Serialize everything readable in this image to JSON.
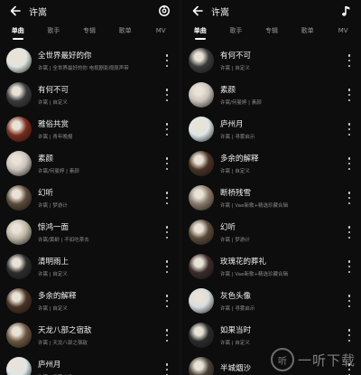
{
  "left": {
    "title": "许嵩",
    "tabs": [
      "单曲",
      "歌手",
      "专辑",
      "歌单",
      "MV"
    ],
    "active_tab": "单曲",
    "top_icon": "shazam-recognize-icon",
    "songs": [
      {
        "name": "全世界最好的你",
        "meta": "许嵩 | 全世界最好的你 电视剧影视原声带",
        "cover": "#dfe6df"
      },
      {
        "name": "有何不可",
        "meta": "许嵩 | 自定义",
        "cover": "#3a3a3a"
      },
      {
        "name": "雅俗共赏",
        "meta": "许嵩 | 青年晚报",
        "cover": "#7a2c1c"
      },
      {
        "name": "素颜",
        "meta": "许嵩/何曼婷 | 素颜",
        "cover": "#c9c3ba"
      },
      {
        "name": "幻听",
        "meta": "许嵩 | 梦游计",
        "cover": "#5a4a3a"
      },
      {
        "name": "惊鸿一面",
        "meta": "许嵩/黄龄 | 不如吃茶去",
        "cover": "#bdb6a6"
      },
      {
        "name": "清明雨上",
        "meta": "许嵩 | 自定义",
        "cover": "#2c2c2c"
      },
      {
        "name": "多余的解释",
        "meta": "许嵩 | 自定义",
        "cover": "#4a3324"
      },
      {
        "name": "天龙八部之宿敌",
        "meta": "许嵩 | 天龙八部之宿敌",
        "cover": "#6b5540"
      },
      {
        "name": "庐州月",
        "meta": "许嵩 | 寻雾启示",
        "cover": "#dde6e8"
      }
    ]
  },
  "right": {
    "title": "许嵩",
    "tabs": [
      "单曲",
      "歌手",
      "专辑",
      "歌单",
      "MV"
    ],
    "active_tab": "单曲",
    "top_icon": "music-note-icon",
    "songs": [
      {
        "name": "有何不可",
        "meta": "许嵩 | 自定义",
        "cover": "#3a3a3a"
      },
      {
        "name": "素颜",
        "meta": "许嵩/何曼婷 | 素颜",
        "cover": "#c9c3ba"
      },
      {
        "name": "庐州月",
        "meta": "许嵩 | 寻雾启示",
        "cover": "#dde6e8"
      },
      {
        "name": "多余的解释",
        "meta": "许嵩 | 自定义",
        "cover": "#4a3324"
      },
      {
        "name": "断桥残雪",
        "meta": "许嵩 | Vae新歌+精选珍藏合辑",
        "cover": "#8a7a6a"
      },
      {
        "name": "幻听",
        "meta": "许嵩 | 梦游计",
        "cover": "#5a4a3a"
      },
      {
        "name": "玫瑰花的葬礼",
        "meta": "许嵩 | Vae新歌+精选珍藏合辑",
        "cover": "#3b2a2a"
      },
      {
        "name": "灰色头像",
        "meta": "许嵩 | 寻雾启示",
        "cover": "#d6dde0"
      },
      {
        "name": "如果当时",
        "meta": "许嵩 | 自定义",
        "cover": "#2a2a2a"
      },
      {
        "name": "半城烟沙",
        "meta": "",
        "cover": "#4a4038"
      }
    ]
  },
  "watermark": {
    "logo": "听",
    "text": "一听下载"
  }
}
